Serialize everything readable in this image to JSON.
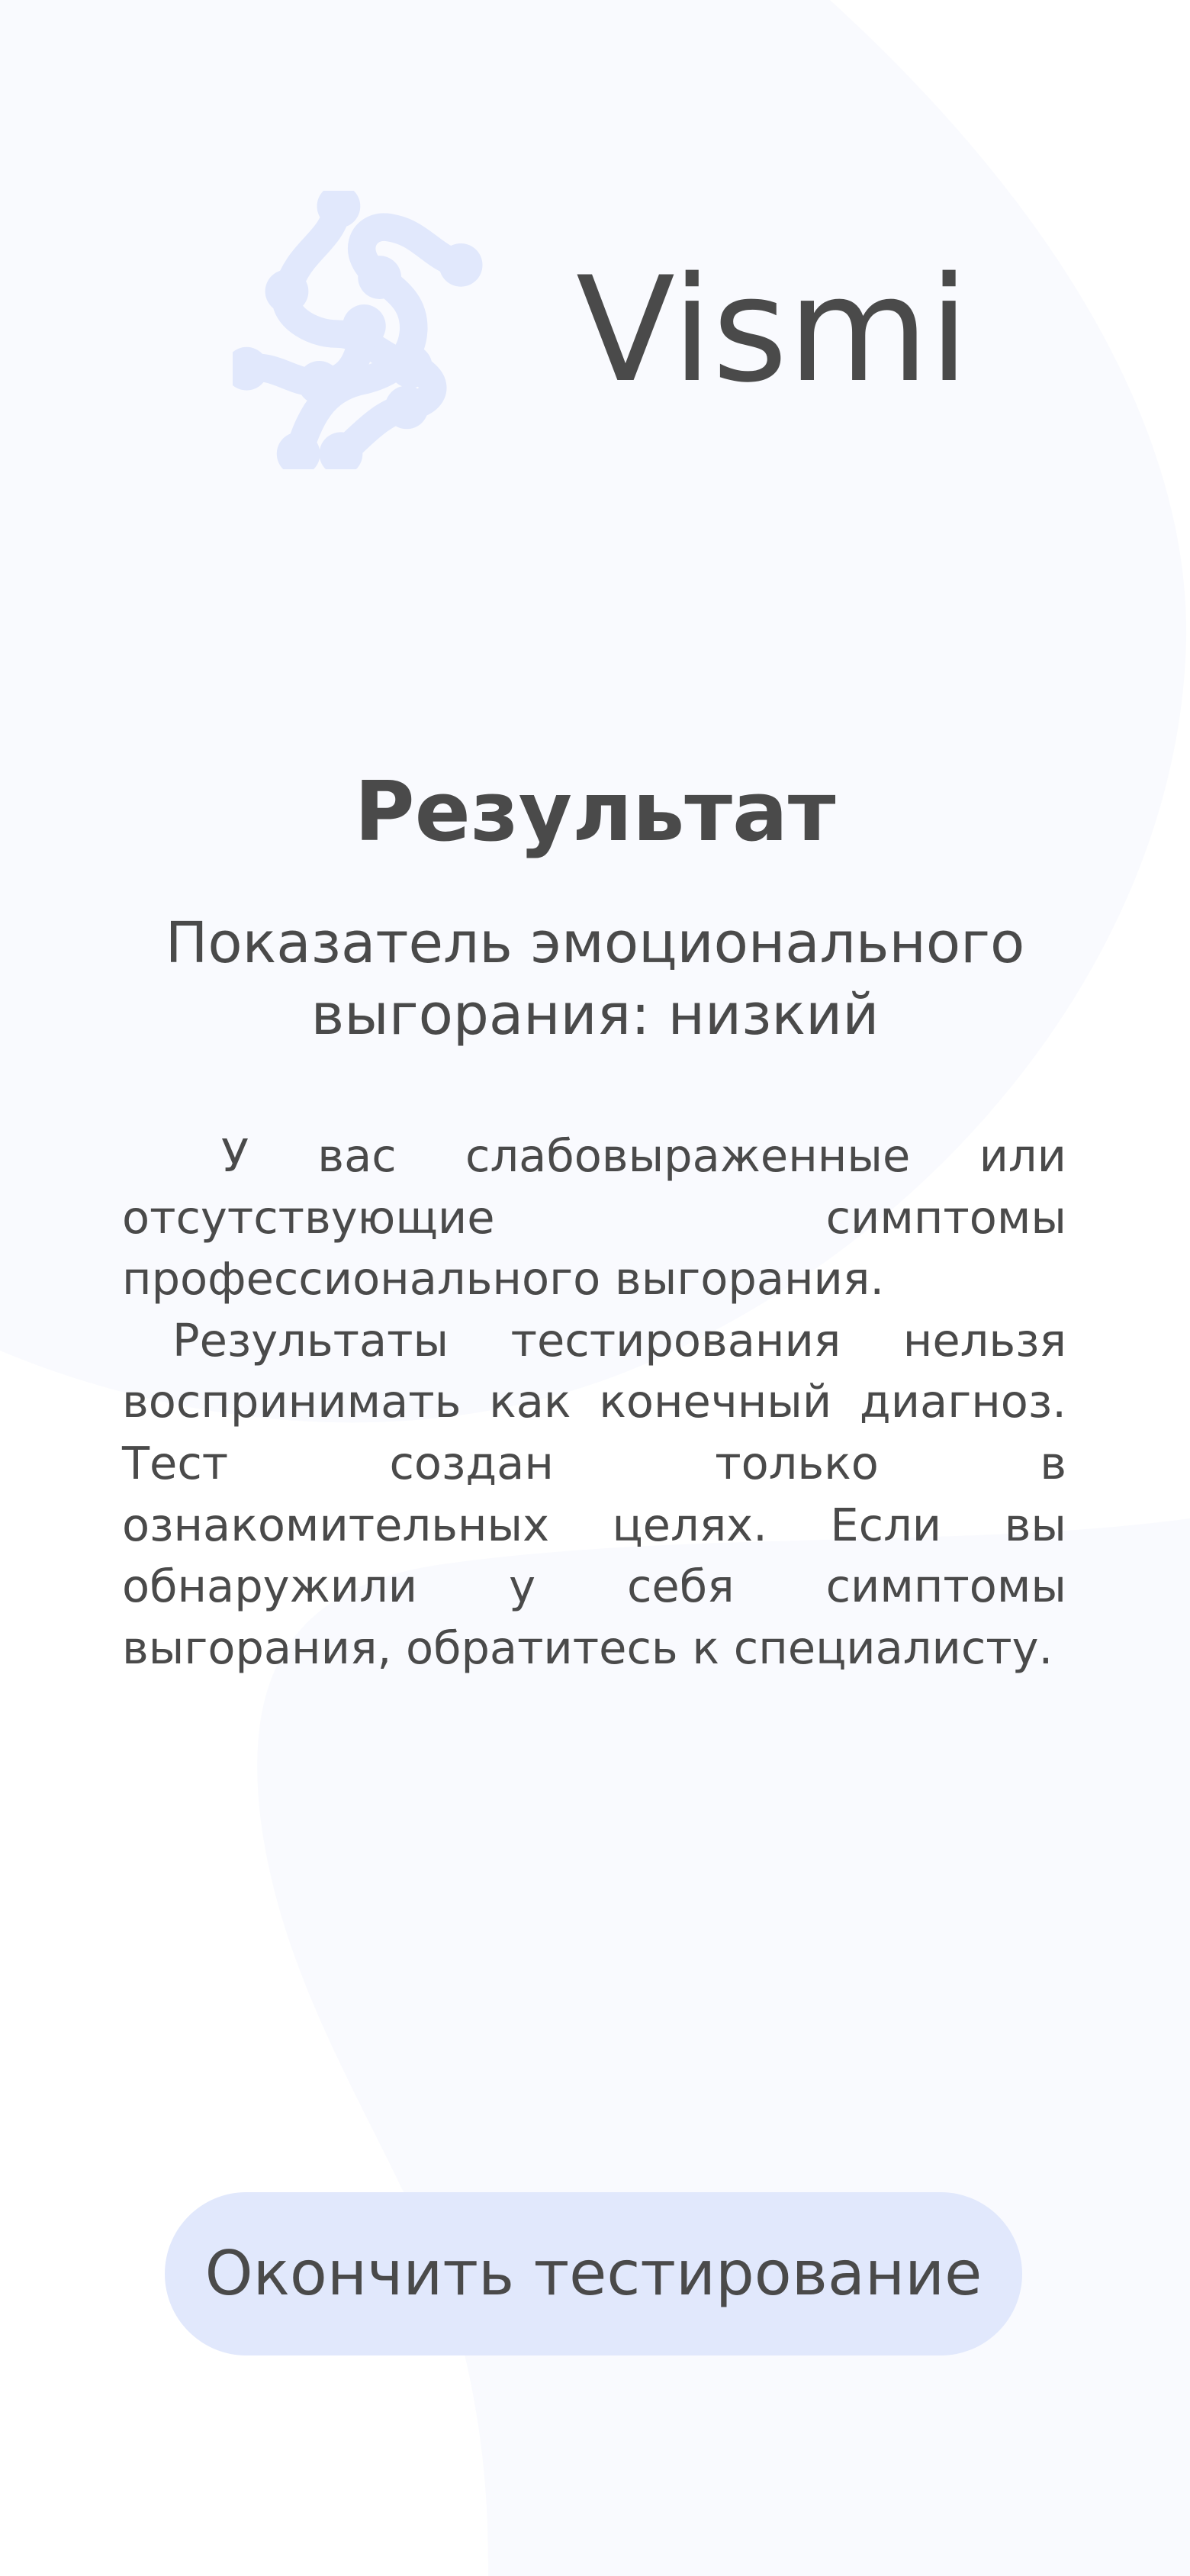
{
  "brand": {
    "name": "Vismi",
    "logo_icon": "molecule-logo-icon"
  },
  "result": {
    "title": "Результат",
    "score_text": "Показатель эмоционального выгорания: низкий",
    "paragraphs": [
      "У вас слабовыраженные или отсутствующие симптомы профессионального выгорания.",
      "Результаты тестирования нельзя воспринимать как конечный диагноз. Тест создан только в ознакомительных целях. Если вы обнаружили у себя симптомы выгорания, обратитесь к специалисту."
    ]
  },
  "actions": {
    "finish_label": "Окончить тестирование"
  },
  "colors": {
    "background": "#ffffff",
    "background_shape": "#f9fafe",
    "logo": "#e1e8fc",
    "text": "#4a4a4a",
    "button": "#e1e8fc"
  }
}
